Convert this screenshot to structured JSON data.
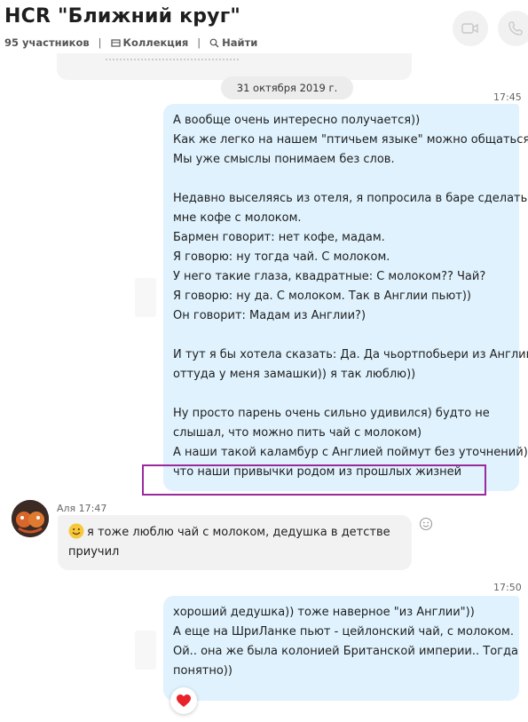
{
  "header": {
    "title": "HCR \"Ближний круг\"",
    "participants": "95 участников",
    "collection": "Коллекция",
    "find": "Найти",
    "sep": "|"
  },
  "date_divider": "31 октября 2019 г.",
  "messages": [
    {
      "time": "17:45",
      "lines": [
        "А вообще очень интересно получается))",
        "Как же легко на нашем \"птичьем языке\" можно общаться))",
        "Мы уже смыслы понимаем без слов.",
        "",
        "Недавно выселяясь из отеля, я попросила в баре сделать",
        "мне кофе с молоком.",
        "Бармен говорит: нет кофе, мадам.",
        "Я говорю: ну тогда чай. С молоком.",
        "У него такие глаза, квадратные: С молоком?? Чай?",
        "Я говорю: ну да. С молоком. Так в Англии пьют))",
        "Он говорит: Мадам из Англии?)",
        "",
        "И тут я бы хотела сказать: Да. Да чьортпобьери из Англии,",
        "оттуда у меня замашки)) я так люблю))",
        "",
        "Ну просто парень очень сильно удивился) будто не",
        "слышал, что можно пить чай с молоком)",
        "А наши такой каламбур с Англией поймут без уточнений)",
        "что наши привычки родом из прошлых жизней"
      ]
    },
    {
      "sender": "Аля 17:47",
      "lines": [
        "я тоже люблю чай с молоком, дедушка в детстве",
        "приучил"
      ]
    },
    {
      "time": "17:50",
      "lines": [
        "хороший дедушка)) тоже наверное \"из Англии\"))",
        "А еще на ШриЛанке пьют - цейлонский чай, с молоком.",
        "Ой.. она же была колонией Британской империи.. Тогда",
        "понятно))"
      ]
    }
  ]
}
